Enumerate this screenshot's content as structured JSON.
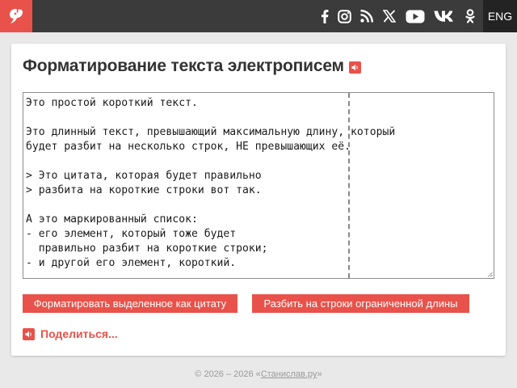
{
  "header": {
    "logo_icon": "phoenix-logo-icon",
    "social_icons": [
      "facebook-icon",
      "instagram-icon",
      "rss-icon",
      "x-icon",
      "youtube-icon",
      "vk-icon",
      "odnoklassniki-icon"
    ],
    "lang_label": "ENG"
  },
  "main": {
    "title": "Форматирование текста электрописем",
    "editor_lines": [
      "Это простой короткий текст.",
      "",
      "Это длинный текст, превышающий максимальную длину, который",
      "будет разбит на несколько строк, НЕ превышающих её.",
      "",
      "> Это цитата, которая будет правильно",
      "> разбита на короткие строки вот так.",
      "",
      "А это маркированный список:",
      "- его элемент, который тоже будет",
      "  правильно разбит на короткие строки;",
      "- и другой его элемент, короткий."
    ],
    "buttons": {
      "quote_label": "Форматировать выделенное как цитату",
      "wrap_label": "Разбить на строки ограниченной длины"
    },
    "share_label": "Поделиться..."
  },
  "footer": {
    "prefix": "© 2026 – 2026 «",
    "link": "Станислав.ру",
    "suffix": "»"
  },
  "colors": {
    "accent": "#e8524a",
    "topbar": "#3b3b3b",
    "lang_bg": "#232323",
    "page_bg": "#e9e9e9"
  }
}
